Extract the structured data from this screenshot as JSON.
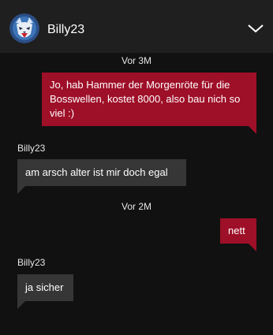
{
  "header": {
    "contact_name": "Billy23",
    "avatar_icon": "wolf-avatar-icon",
    "collapse_icon": "chevron-down-icon"
  },
  "colors": {
    "outgoing_bubble": "#9e0f28",
    "incoming_bubble": "#363636",
    "header_bg": "#1f1f1f",
    "background": "#111111"
  },
  "conversation": {
    "timestamp_1": "Vor 3M",
    "msg_1": "Jo, hab Hammer der Morgenröte für die Bosswellen, kostet 8000, also bau nich so viel :)",
    "sender_2": "Billy23",
    "msg_2": "am arsch alter ist mir doch egal",
    "timestamp_2": "Vor 2M",
    "msg_3": "nett",
    "sender_4": "Billy23",
    "msg_4": "ja sicher"
  }
}
